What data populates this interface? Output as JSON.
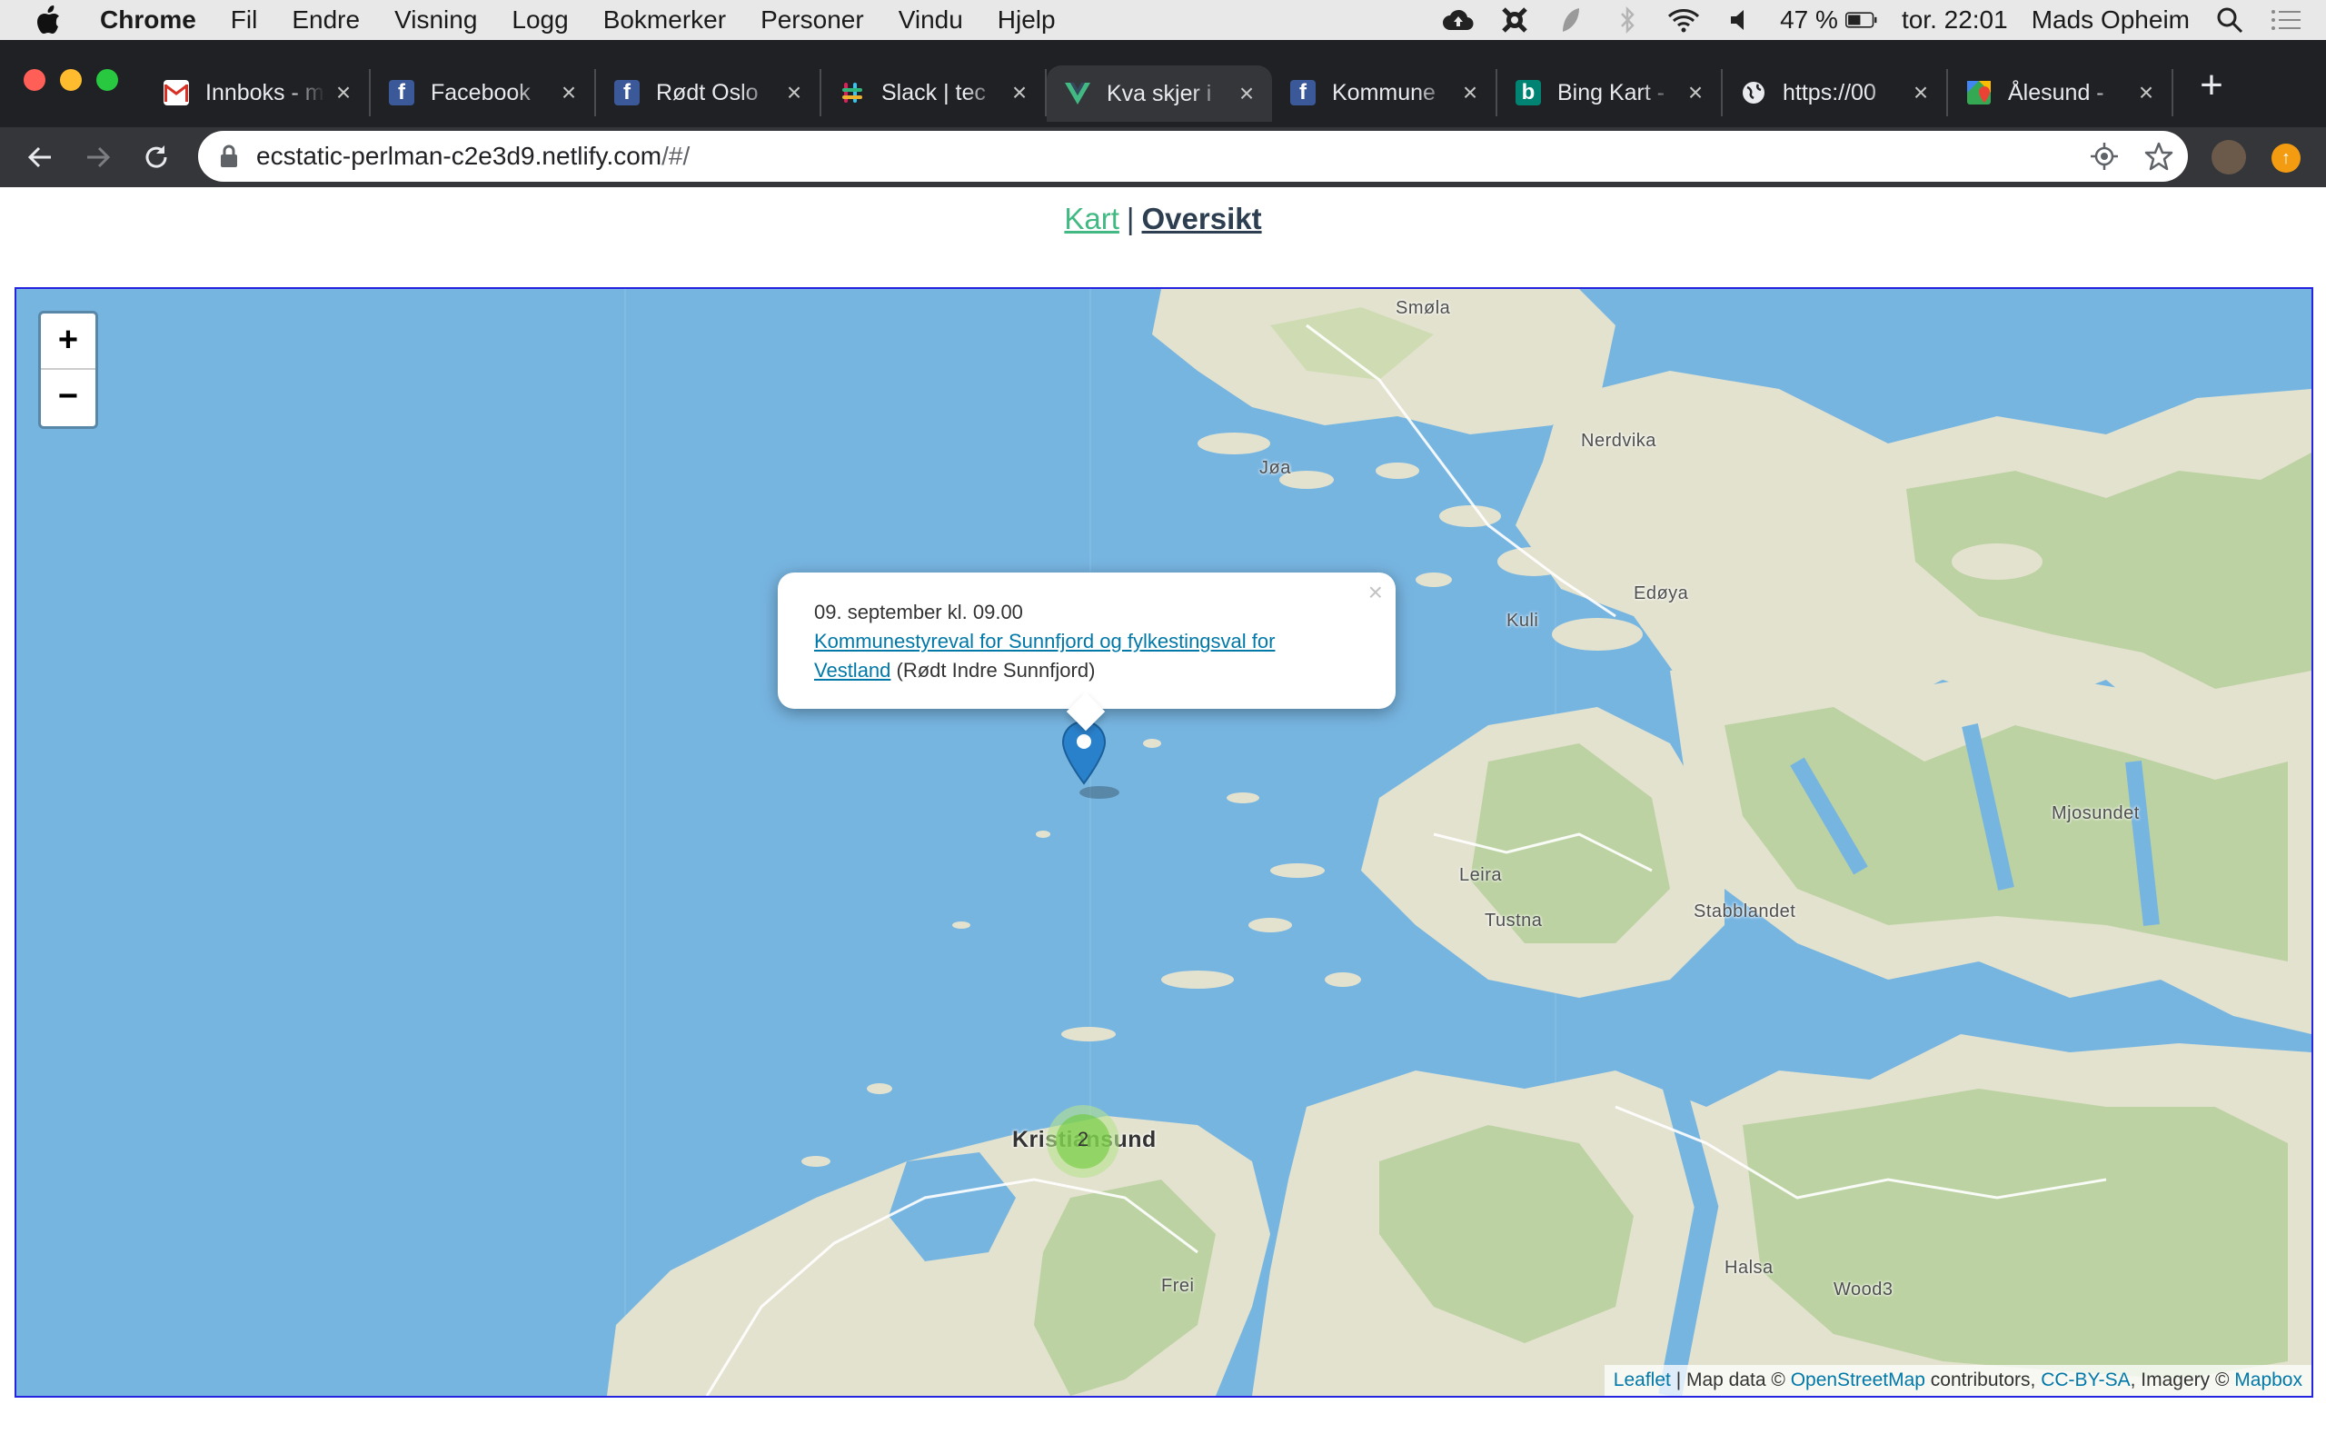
{
  "menubar": {
    "app_name": "Chrome",
    "items": [
      "Fil",
      "Endre",
      "Visning",
      "Logg",
      "Bokmerker",
      "Personer",
      "Vindu",
      "Hjelp"
    ],
    "battery": "47 %",
    "clock": "tor. 22:01",
    "user": "Mads Opheim"
  },
  "tabs": [
    {
      "title": "Innboks - m",
      "icon": "gmail-icon",
      "active": false
    },
    {
      "title": "Facebook",
      "icon": "facebook-icon",
      "active": false
    },
    {
      "title": "Rødt Oslo",
      "icon": "facebook-icon",
      "active": false
    },
    {
      "title": "Slack | tec",
      "icon": "slack-icon",
      "active": false
    },
    {
      "title": "Kva skjer i",
      "icon": "vue-icon",
      "active": true
    },
    {
      "title": "Kommune",
      "icon": "facebook-icon",
      "active": false
    },
    {
      "title": "Bing Kart -",
      "icon": "bing-icon",
      "active": false
    },
    {
      "title": "https://00",
      "icon": "globe-icon",
      "active": false
    },
    {
      "title": "Ålesund -",
      "icon": "google-maps-icon",
      "active": false
    }
  ],
  "address": {
    "host": "ecstatic-perlman-c2e3d9.netlify.com",
    "path": "/#/"
  },
  "page_nav": {
    "kart": "Kart",
    "separator": "|",
    "oversikt": "Oversikt"
  },
  "map": {
    "zoom_in": "+",
    "zoom_out": "−",
    "labels": [
      "Smøla",
      "Nerdvika",
      "Jøa",
      "Kuli",
      "Edøya",
      "Leira",
      "Tustna",
      "Stabblandet",
      "Mjosundet",
      "Kristiansund",
      "Frei",
      "Halsa",
      "Wood3"
    ],
    "popup": {
      "date": "09. september kl. 09.00",
      "event_link": "Kommunestyreval for Sunnfjord og fylkestingsval for Vestland",
      "organizer": "(Rødt Indre Sunnfjord)",
      "close": "×"
    },
    "cluster_count": "2",
    "attribution": {
      "leaflet": "Leaflet",
      "text1": " | Map data © ",
      "osm": "OpenStreetMap",
      "text2": " contributors, ",
      "license": "CC-BY-SA",
      "text3": ", Imagery © ",
      "mapbox": "Mapbox"
    }
  },
  "colors": {
    "water": "#77b5e1",
    "land": "#e3e2cf",
    "vegetation": "#bcd2a2",
    "link_green": "#42b983",
    "link_dark": "#2c3e50",
    "marker_blue": "#2a81cb",
    "map_border": "#2323e0"
  }
}
